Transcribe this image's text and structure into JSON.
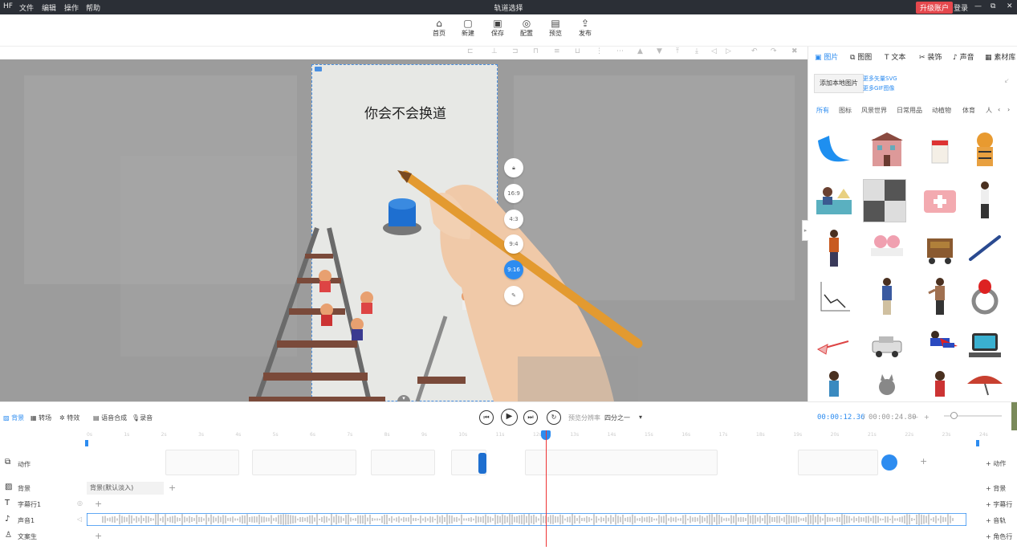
{
  "titlebar": {
    "logo": "HF",
    "menu": [
      "文件",
      "编辑",
      "操作",
      "帮助"
    ],
    "title": "轨道选择",
    "upgrade": "升级账户",
    "login": "登录",
    "min": "—",
    "max": "⧉",
    "close": "✕"
  },
  "toolbar": {
    "items": [
      {
        "label": "首页",
        "icon": "home-icon"
      },
      {
        "label": "新建",
        "icon": "new-file-icon"
      },
      {
        "label": "保存",
        "icon": "save-icon"
      },
      {
        "label": "配置",
        "icon": "settings-icon"
      },
      {
        "label": "预览",
        "icon": "preview-icon"
      },
      {
        "label": "发布",
        "icon": "publish-icon"
      }
    ]
  },
  "canvas": {
    "slide_text": "你会不会换道",
    "ratios": [
      "16:9",
      "4:3",
      "9:4",
      "9:16"
    ],
    "active_ratio": "9:16"
  },
  "rpanel": {
    "tabs": [
      "图片",
      "图图",
      "文本",
      "装饰",
      "声音",
      "素材库"
    ],
    "active_tab": "图片",
    "add_local": "添加本地图片",
    "more_svg": "更多矢量SVG",
    "more_gif": "更多GIF图像",
    "categories": [
      "所有",
      "图标",
      "风景世界",
      "日常用品",
      "动植物",
      "体育",
      "人"
    ],
    "active_category": "所有"
  },
  "playbar": {
    "tools": [
      "背景",
      "转场",
      "特效",
      "语音合成",
      "录音"
    ],
    "active_tool": "背景",
    "preview_label": "预览分辨率",
    "resolution": "四分之一",
    "time_current": "00:00:12.36",
    "time_sep": "/",
    "time_total": "00:00:24.80",
    "zoom_minus": "—",
    "zoom_plus": "+"
  },
  "timeline": {
    "ruler_ticks": [
      "0s",
      "1s",
      "2s",
      "3s",
      "4s",
      "5s",
      "6s",
      "7s",
      "8s",
      "9s",
      "10s",
      "11s",
      "12s",
      "13s",
      "14s",
      "15s",
      "16s",
      "17s",
      "18s",
      "19s",
      "20s",
      "21s",
      "22s",
      "23s",
      "24s"
    ],
    "tracks": [
      {
        "label": "动作",
        "add": "+ 动作"
      },
      {
        "label": "背景",
        "add": "+ 背景"
      },
      {
        "label": "字幕行1",
        "add": "+ 字幕行"
      },
      {
        "label": "声音1",
        "add": "+ 音轨"
      },
      {
        "label": "文案生",
        "add": "+ 角色行"
      }
    ],
    "bg_clip": "背景(默认淡入)",
    "playhead_pct": 0.514
  }
}
